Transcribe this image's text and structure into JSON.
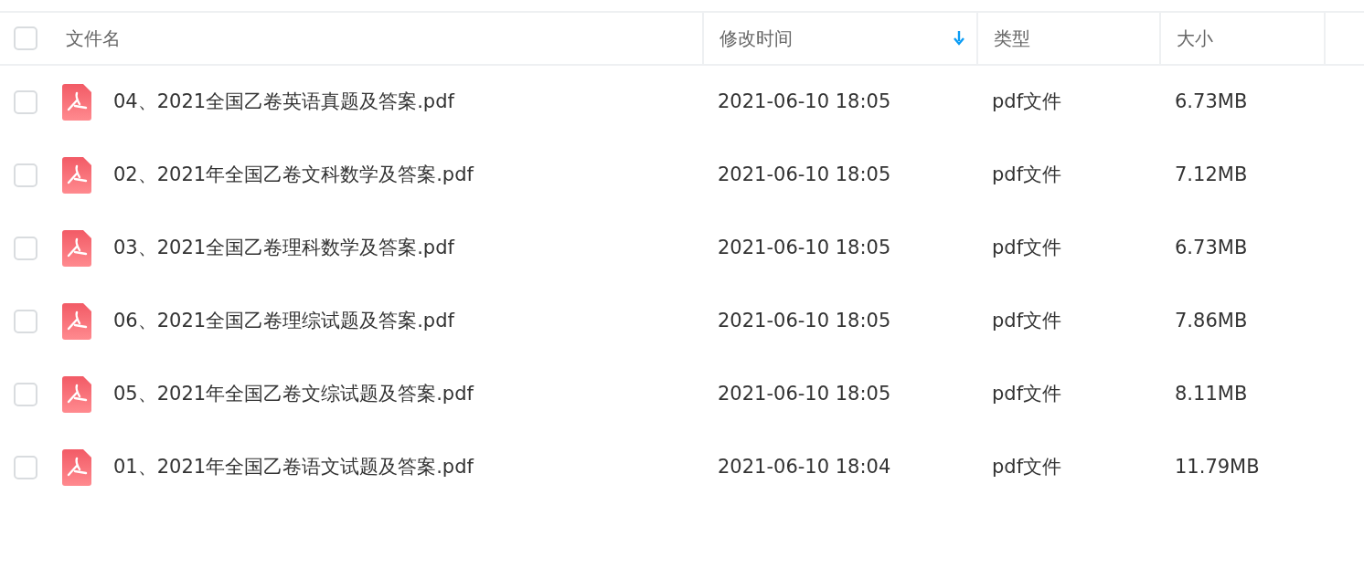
{
  "table": {
    "select_all": {
      "checked": false
    },
    "columns": [
      {
        "label": "文件名",
        "sorted": false
      },
      {
        "label": "修改时间",
        "sorted": true
      },
      {
        "label": "类型",
        "sorted": false
      },
      {
        "label": "大小",
        "sorted": false
      }
    ],
    "rows": [
      {
        "name": "04、2021全国乙卷英语真题及答案.pdf",
        "modified": "2021-06-10 18:05",
        "type": "pdf文件",
        "size": "6.73MB",
        "checked": false
      },
      {
        "name": "02、2021年全国乙卷文科数学及答案.pdf",
        "modified": "2021-06-10 18:05",
        "type": "pdf文件",
        "size": "7.12MB",
        "checked": false
      },
      {
        "name": "03、2021全国乙卷理科数学及答案.pdf",
        "modified": "2021-06-10 18:05",
        "type": "pdf文件",
        "size": "6.73MB",
        "checked": false
      },
      {
        "name": "06、2021全国乙卷理综试题及答案.pdf",
        "modified": "2021-06-10 18:05",
        "type": "pdf文件",
        "size": "7.86MB",
        "checked": false
      },
      {
        "name": "05、2021年全国乙卷文综试题及答案.pdf",
        "modified": "2021-06-10 18:05",
        "type": "pdf文件",
        "size": "8.11MB",
        "checked": false
      },
      {
        "name": "01、2021年全国乙卷语文试题及答案.pdf",
        "modified": "2021-06-10 18:04",
        "type": "pdf文件",
        "size": "11.79MB",
        "checked": false
      }
    ]
  }
}
